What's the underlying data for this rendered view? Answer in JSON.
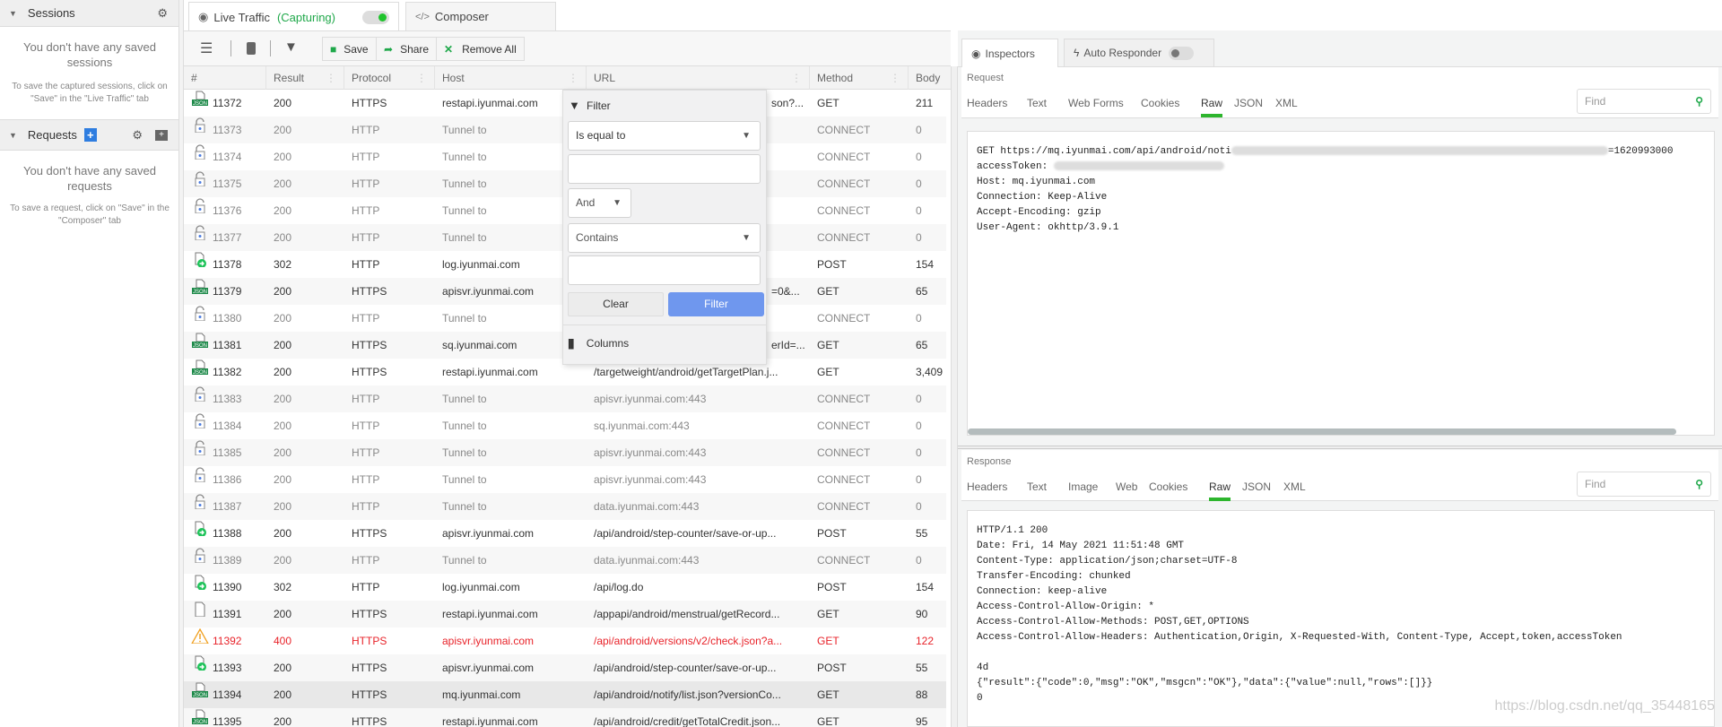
{
  "sidebar": {
    "sessions": {
      "title": "Sessions",
      "empty_title": "You don't have any saved sessions",
      "empty_sub": "To save the captured sessions, click on \"Save\" in the \"Live Traffic\" tab"
    },
    "requests": {
      "title": "Requests",
      "empty_title": "You don't have any saved requests",
      "empty_sub": "To save a request, click on \"Save\" in the \"Composer\" tab"
    }
  },
  "main_tabs": {
    "live": "Live Traffic",
    "capturing": "(Capturing)",
    "composer": "Composer",
    "capture_on": true
  },
  "toolbar": {
    "save": "Save",
    "share": "Share",
    "remove_all": "Remove All"
  },
  "columns": [
    "#",
    "Result",
    "Protocol",
    "Host",
    "URL",
    "Method",
    "Body"
  ],
  "rows": [
    {
      "icon": "json",
      "id": "11372",
      "result": "200",
      "protocol": "HTTPS",
      "host": "restapi.iyunmai.com",
      "url": "son?...",
      "method": "GET",
      "body": "211",
      "state": "normal",
      "url_hidden": true
    },
    {
      "icon": "lock",
      "id": "11373",
      "result": "200",
      "protocol": "HTTP",
      "host": "Tunnel to",
      "url": "",
      "method": "CONNECT",
      "body": "0",
      "state": "dim"
    },
    {
      "icon": "lock",
      "id": "11374",
      "result": "200",
      "protocol": "HTTP",
      "host": "Tunnel to",
      "url": "",
      "method": "CONNECT",
      "body": "0",
      "state": "dim"
    },
    {
      "icon": "lock",
      "id": "11375",
      "result": "200",
      "protocol": "HTTP",
      "host": "Tunnel to",
      "url": "",
      "method": "CONNECT",
      "body": "0",
      "state": "dim"
    },
    {
      "icon": "lock",
      "id": "11376",
      "result": "200",
      "protocol": "HTTP",
      "host": "Tunnel to",
      "url": "",
      "method": "CONNECT",
      "body": "0",
      "state": "dim"
    },
    {
      "icon": "lock",
      "id": "11377",
      "result": "200",
      "protocol": "HTTP",
      "host": "Tunnel to",
      "url": "",
      "method": "CONNECT",
      "body": "0",
      "state": "dim"
    },
    {
      "icon": "redirect",
      "id": "11378",
      "result": "302",
      "protocol": "HTTP",
      "host": "log.iyunmai.com",
      "url": "",
      "method": "POST",
      "body": "154",
      "state": "normal"
    },
    {
      "icon": "json",
      "id": "11379",
      "result": "200",
      "protocol": "HTTPS",
      "host": "apisvr.iyunmai.com",
      "url": "=0&...",
      "method": "GET",
      "body": "65",
      "state": "normal",
      "url_hidden": true
    },
    {
      "icon": "lock",
      "id": "11380",
      "result": "200",
      "protocol": "HTTP",
      "host": "Tunnel to",
      "url": "",
      "method": "CONNECT",
      "body": "0",
      "state": "dim"
    },
    {
      "icon": "json",
      "id": "11381",
      "result": "200",
      "protocol": "HTTPS",
      "host": "sq.iyunmai.com",
      "url": "erId=...",
      "method": "GET",
      "body": "65",
      "state": "normal",
      "url_hidden": true
    },
    {
      "icon": "json",
      "id": "11382",
      "result": "200",
      "protocol": "HTTPS",
      "host": "restapi.iyunmai.com",
      "url": "/targetweight/android/getTargetPlan.j...",
      "method": "GET",
      "body": "3,409",
      "state": "normal"
    },
    {
      "icon": "lock",
      "id": "11383",
      "result": "200",
      "protocol": "HTTP",
      "host": "Tunnel to",
      "url": "apisvr.iyunmai.com:443",
      "method": "CONNECT",
      "body": "0",
      "state": "dim"
    },
    {
      "icon": "lock",
      "id": "11384",
      "result": "200",
      "protocol": "HTTP",
      "host": "Tunnel to",
      "url": "sq.iyunmai.com:443",
      "method": "CONNECT",
      "body": "0",
      "state": "dim"
    },
    {
      "icon": "lock",
      "id": "11385",
      "result": "200",
      "protocol": "HTTP",
      "host": "Tunnel to",
      "url": "apisvr.iyunmai.com:443",
      "method": "CONNECT",
      "body": "0",
      "state": "dim"
    },
    {
      "icon": "lock",
      "id": "11386",
      "result": "200",
      "protocol": "HTTP",
      "host": "Tunnel to",
      "url": "apisvr.iyunmai.com:443",
      "method": "CONNECT",
      "body": "0",
      "state": "dim"
    },
    {
      "icon": "lock",
      "id": "11387",
      "result": "200",
      "protocol": "HTTP",
      "host": "Tunnel to",
      "url": "data.iyunmai.com:443",
      "method": "CONNECT",
      "body": "0",
      "state": "dim"
    },
    {
      "icon": "redirect",
      "id": "11388",
      "result": "200",
      "protocol": "HTTPS",
      "host": "apisvr.iyunmai.com",
      "url": "/api/android/step-counter/save-or-up...",
      "method": "POST",
      "body": "55",
      "state": "normal"
    },
    {
      "icon": "lock",
      "id": "11389",
      "result": "200",
      "protocol": "HTTP",
      "host": "Tunnel to",
      "url": "data.iyunmai.com:443",
      "method": "CONNECT",
      "body": "0",
      "state": "dim"
    },
    {
      "icon": "redirect",
      "id": "11390",
      "result": "302",
      "protocol": "HTTP",
      "host": "log.iyunmai.com",
      "url": "/api/log.do",
      "method": "POST",
      "body": "154",
      "state": "normal"
    },
    {
      "icon": "doc",
      "id": "11391",
      "result": "200",
      "protocol": "HTTPS",
      "host": "restapi.iyunmai.com",
      "url": "/appapi/android/menstrual/getRecord...",
      "method": "GET",
      "body": "90",
      "state": "normal"
    },
    {
      "icon": "warning",
      "id": "11392",
      "result": "400",
      "protocol": "HTTPS",
      "host": "apisvr.iyunmai.com",
      "url": "/api/android/versions/v2/check.json?a...",
      "method": "GET",
      "body": "122",
      "state": "error"
    },
    {
      "icon": "redirect",
      "id": "11393",
      "result": "200",
      "protocol": "HTTPS",
      "host": "apisvr.iyunmai.com",
      "url": "/api/android/step-counter/save-or-up...",
      "method": "POST",
      "body": "55",
      "state": "normal"
    },
    {
      "icon": "json",
      "id": "11394",
      "result": "200",
      "protocol": "HTTPS",
      "host": "mq.iyunmai.com",
      "url": "/api/android/notify/list.json?versionCo...",
      "method": "GET",
      "body": "88",
      "state": "selected"
    },
    {
      "icon": "json",
      "id": "11395",
      "result": "200",
      "protocol": "HTTPS",
      "host": "restapi.iyunmai.com",
      "url": "/api/android/credit/getTotalCredit.json...",
      "method": "GET",
      "body": "95",
      "state": "normal"
    }
  ],
  "filter_popup": {
    "title": "Filter",
    "op1": "Is equal to",
    "value1": "",
    "logic": "And",
    "op2": "Contains",
    "value2": "",
    "clear": "Clear",
    "filter": "Filter",
    "columns": "Columns"
  },
  "right": {
    "tabs": {
      "inspectors": "Inspectors",
      "auto_responder": "Auto Responder",
      "auto_responder_on": false
    },
    "request": {
      "label": "Request",
      "tabs": [
        "Headers",
        "Text",
        "Web Forms",
        "Cookies",
        "Raw",
        "JSON",
        "XML"
      ],
      "active": "Raw",
      "find_placeholder": "Find",
      "lines": [
        "GET https://mq.iyunmai.com/api/android/noti",
        "=1620993000",
        "accessToken: ",
        "Host: mq.iyunmai.com",
        "Connection: Keep-Alive",
        "Accept-Encoding: gzip",
        "User-Agent: okhttp/3.9.1"
      ]
    },
    "response": {
      "label": "Response",
      "tabs": [
        "Headers",
        "Text",
        "Image",
        "Web",
        "Cookies",
        "Raw",
        "JSON",
        "XML"
      ],
      "active": "Raw",
      "find_placeholder": "Find",
      "lines": [
        "HTTP/1.1 200",
        "Date: Fri, 14 May 2021 11:51:48 GMT",
        "Content-Type: application/json;charset=UTF-8",
        "Transfer-Encoding: chunked",
        "Connection: keep-alive",
        "Access-Control-Allow-Origin: *",
        "Access-Control-Allow-Methods: POST,GET,OPTIONS",
        "Access-Control-Allow-Headers: Authentication,Origin, X-Requested-With, Content-Type, Accept,token,accessToken",
        "",
        "4d",
        "{\"result\":{\"code\":0,\"msg\":\"OK\",\"msgcn\":\"OK\"},\"data\":{\"value\":null,\"rows\":[]}}",
        "0"
      ]
    }
  },
  "watermark": "https://blog.csdn.net/qq_35448165",
  "colors": {
    "accent_green": "#2db52d",
    "capturing": "#1fa84a",
    "filter_button": "#6f97ee",
    "error": "#e8232a",
    "json_badge": "#1e8a4a"
  }
}
